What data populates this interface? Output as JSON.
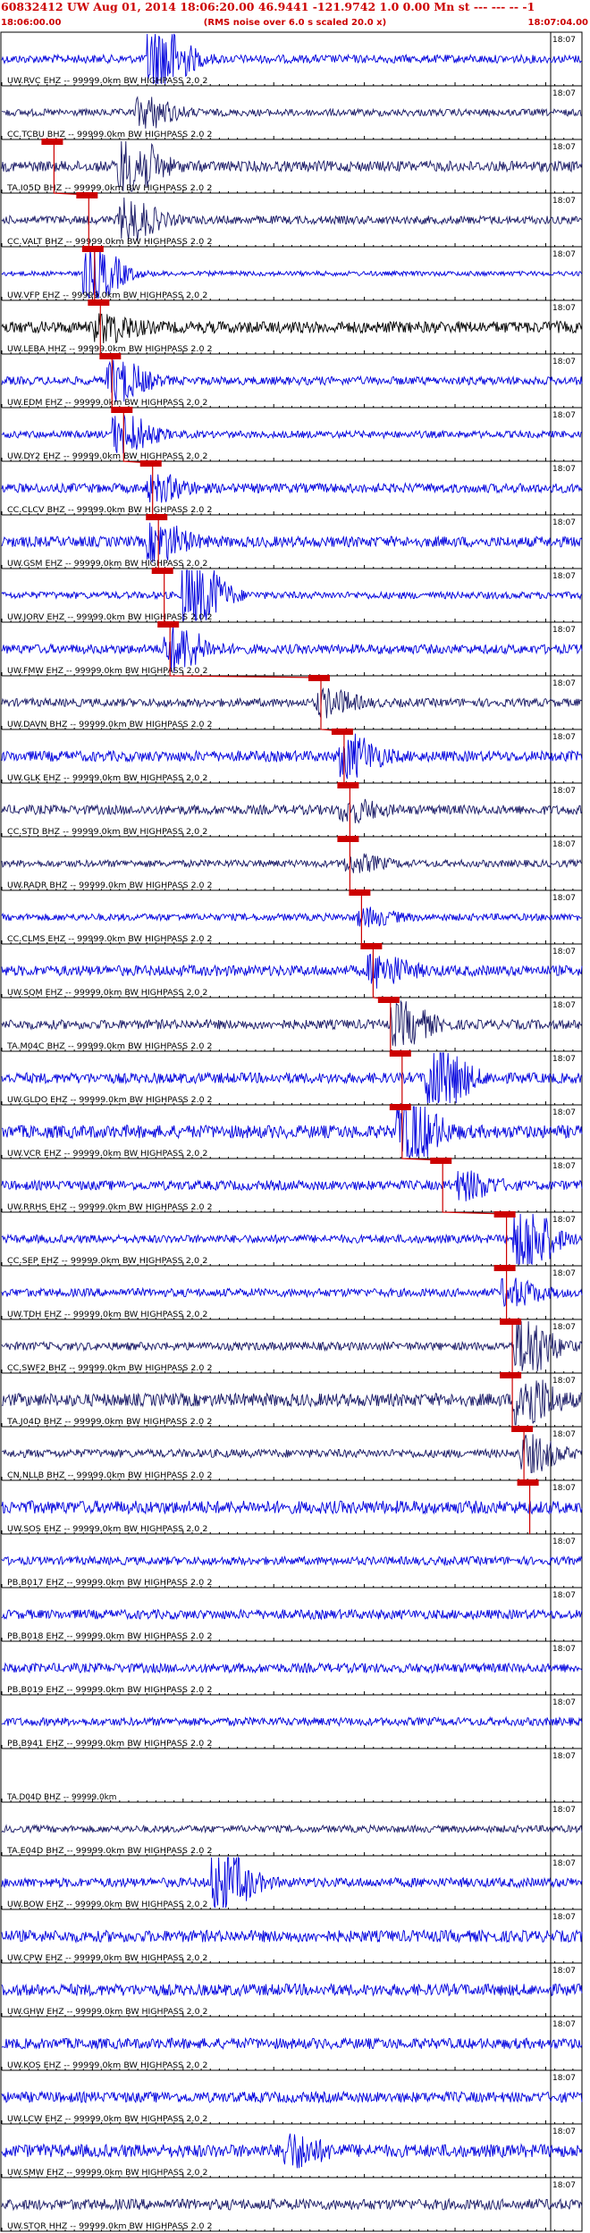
{
  "header": {
    "title": "60832412 UW Aug 01, 2014 18:06:20.00    46.9441 -121.9742  1.0 0.00 Mn st --- --- --  -1",
    "start_time": "18:06:00.00",
    "rms_note": "(RMS noise over 6.0 s scaled 20.0 x)",
    "end_time": "18:07:04.00"
  },
  "chart_data": {
    "type": "line",
    "title": "60832412 UW Aug 01, 2014 18:06:20.00    46.9441 -121.9742  1.0 0.00 Mn st --- --- --  -1",
    "xlabel": "",
    "ylabel": "",
    "x_range": [
      "18:06:00.00",
      "18:07:04.00"
    ],
    "minute_label": "18:07",
    "colors": {
      "title": "#cc0000",
      "grid": "#000000",
      "pick": "#cc0000",
      "trace_blue": "#0000dd",
      "trace_dark": "#1a1a66",
      "trace_black": "#000000"
    },
    "channels": [
      {
        "label": "UW.RVC EHZ -- 99999.0km BW  HIGHPASS  2.0  2",
        "pick": null,
        "color": "blue",
        "burst": 0.27,
        "burst_amp": 3.2,
        "noise": 0.35
      },
      {
        "label": "CC.TCBU BHZ -- 99999.0km BW  HIGHPASS  2.0  2",
        "pick": null,
        "color": "dark",
        "burst": 0.25,
        "burst_amp": 1.2,
        "noise": 0.3
      },
      {
        "label": "TA.I05D BHZ -- 99999.0km BW  HIGHPASS  2.0  2",
        "pick": 0.09,
        "color": "dark",
        "burst": 0.22,
        "burst_amp": 2.6,
        "noise": 0.45
      },
      {
        "label": "CC.VALT BHZ -- 99999.0km BW  HIGHPASS  2.0  2",
        "pick": 0.15,
        "color": "dark",
        "burst": 0.22,
        "burst_amp": 1.6,
        "noise": 0.35
      },
      {
        "label": "UW.VFP EHZ -- 99999.0km BW  HIGHPASS  2.0  2",
        "pick": 0.16,
        "color": "blue",
        "burst": 0.16,
        "burst_amp": 2.2,
        "noise": 0.2
      },
      {
        "label": "UW.LEBA HHZ -- 99999.0km BW  HIGHPASS  2.0  2",
        "pick": 0.17,
        "color": "black",
        "burst": 0.18,
        "burst_amp": 1.0,
        "noise": 0.5
      },
      {
        "label": "UW.EDM EHZ -- 99999.0km BW  HIGHPASS  2.0  2",
        "pick": 0.19,
        "color": "blue",
        "burst": 0.2,
        "burst_amp": 1.6,
        "noise": 0.35
      },
      {
        "label": "UW.DY2 EHZ -- 99999.0km BW  HIGHPASS  2.0  2",
        "pick": 0.21,
        "color": "blue",
        "burst": 0.21,
        "burst_amp": 1.6,
        "noise": 0.3
      },
      {
        "label": "CC.CLCV BHZ -- 99999.0km BW  HIGHPASS  2.0  2",
        "pick": 0.26,
        "color": "blue",
        "burst": 0.27,
        "burst_amp": 0.9,
        "noise": 0.4
      },
      {
        "label": "UW.GSM EHZ -- 99999.0km BW  HIGHPASS  2.0  2",
        "pick": 0.27,
        "color": "blue",
        "burst": 0.27,
        "burst_amp": 1.4,
        "noise": 0.45
      },
      {
        "label": "UW.JORV EHZ -- 99999.0km BW  HIGHPASS  2.0  2",
        "pick": 0.28,
        "color": "blue",
        "burst": 0.33,
        "burst_amp": 3.4,
        "noise": 0.3
      },
      {
        "label": "UW.FMW EHZ -- 99999.0km BW  HIGHPASS  2.0  2",
        "pick": 0.29,
        "color": "blue",
        "burst": 0.3,
        "burst_amp": 1.8,
        "noise": 0.4
      },
      {
        "label": "UW.DAVN BHZ -- 99999.0km BW  HIGHPASS  2.0  2",
        "pick": 0.55,
        "color": "dark",
        "burst": 0.56,
        "burst_amp": 1.0,
        "noise": 0.35
      },
      {
        "label": "UW.GLK EHZ -- 99999.0km BW  HIGHPASS  2.0  2",
        "pick": 0.59,
        "color": "blue",
        "burst": 0.6,
        "burst_amp": 1.6,
        "noise": 0.45
      },
      {
        "label": "CC.STD BHZ -- 99999.0km BW  HIGHPASS  2.0  2",
        "pick": 0.6,
        "color": "dark",
        "burst": 0.6,
        "burst_amp": 0.8,
        "noise": 0.4
      },
      {
        "label": "UW.RADR BHZ -- 99999.0km BW  HIGHPASS  2.0  2",
        "pick": 0.6,
        "color": "dark",
        "burst": 0.61,
        "burst_amp": 0.6,
        "noise": 0.3
      },
      {
        "label": "CC.CLMS EHZ -- 99999.0km BW  HIGHPASS  2.0  2",
        "pick": 0.62,
        "color": "blue",
        "burst": 0.63,
        "burst_amp": 0.6,
        "noise": 0.3
      },
      {
        "label": "UW.SQM EHZ -- 99999.0km BW  HIGHPASS  2.0  2",
        "pick": 0.64,
        "color": "blue",
        "burst": 0.65,
        "burst_amp": 1.2,
        "noise": 0.45
      },
      {
        "label": "TA.M04C BHZ -- 99999.0km BW  HIGHPASS  2.0  2",
        "pick": 0.67,
        "color": "dark",
        "burst": 0.69,
        "burst_amp": 1.6,
        "noise": 0.4
      },
      {
        "label": "UW.GLDO EHZ -- 99999.0km BW  HIGHPASS  2.0  2",
        "pick": 0.69,
        "color": "blue",
        "burst": 0.75,
        "burst_amp": 3.0,
        "noise": 0.45
      },
      {
        "label": "UW.VCR EHZ -- 99999.0km BW  HIGHPASS  2.0  2",
        "pick": 0.69,
        "color": "blue",
        "burst": 0.7,
        "burst_amp": 3.0,
        "noise": 0.55
      },
      {
        "label": "UW.RRHS EHZ -- 99999.0km BW  HIGHPASS  2.0  2",
        "pick": 0.76,
        "color": "blue",
        "burst": 0.8,
        "burst_amp": 1.0,
        "noise": 0.4
      },
      {
        "label": "CC.SEP EHZ -- 99999.0km BW  HIGHPASS  2.0  2",
        "pick": 0.87,
        "color": "blue",
        "burst": 0.9,
        "burst_amp": 3.0,
        "noise": 0.35
      },
      {
        "label": "UW.TDH EHZ -- 99999.0km BW  HIGHPASS  2.0  2",
        "pick": 0.87,
        "color": "blue",
        "burst": 0.88,
        "burst_amp": 1.0,
        "noise": 0.35
      },
      {
        "label": "CC.SWF2 BHZ -- 99999.0km BW  HIGHPASS  2.0  2",
        "pick": 0.88,
        "color": "dark",
        "burst": 0.9,
        "burst_amp": 2.6,
        "noise": 0.35
      },
      {
        "label": "TA.J04D BHZ -- 99999.0km BW  HIGHPASS  2.0  2",
        "pick": 0.88,
        "color": "dark",
        "burst": 0.9,
        "burst_amp": 2.2,
        "noise": 0.55
      },
      {
        "label": "CN.NLLB BHZ -- 99999.0km BW  HIGHPASS  2.0  2",
        "pick": 0.9,
        "color": "dark",
        "burst": 0.91,
        "burst_amp": 1.4,
        "noise": 0.35
      },
      {
        "label": "UW.SOS EHZ -- 99999.0km BW  HIGHPASS  2.0  2",
        "pick": 0.91,
        "color": "blue",
        "burst": null,
        "burst_amp": 0,
        "noise": 0.55
      },
      {
        "label": "PB.B017 EHZ -- 99999.0km BW  HIGHPASS  2.0  2",
        "pick": null,
        "color": "blue",
        "burst": null,
        "burst_amp": 0,
        "noise": 0.35
      },
      {
        "label": "PB.B018 EHZ -- 99999.0km BW  HIGHPASS  2.0  2",
        "pick": null,
        "color": "blue",
        "burst": null,
        "burst_amp": 0,
        "noise": 0.4
      },
      {
        "label": "PB.B019 EHZ -- 99999.0km BW  HIGHPASS  2.0  2",
        "pick": null,
        "color": "blue",
        "burst": null,
        "burst_amp": 0,
        "noise": 0.4
      },
      {
        "label": "PB.B941 EHZ -- 99999.0km BW  HIGHPASS  2.0  2",
        "pick": null,
        "color": "blue",
        "burst": null,
        "burst_amp": 0,
        "noise": 0.35
      },
      {
        "label": "TA.D04D BHZ -- 99999.0km",
        "pick": null,
        "color": "blue",
        "burst": null,
        "burst_amp": 0,
        "noise": 0.0
      },
      {
        "label": "TA.E04D BHZ -- 99999.0km BW  HIGHPASS  2.0  2",
        "pick": null,
        "color": "dark",
        "burst": null,
        "burst_amp": 0,
        "noise": 0.3
      },
      {
        "label": "UW.BOW EHZ -- 99999.0km BW  HIGHPASS  2.0  2",
        "pick": null,
        "color": "blue",
        "burst": 0.38,
        "burst_amp": 2.6,
        "noise": 0.4
      },
      {
        "label": "UW.CPW EHZ -- 99999.0km BW  HIGHPASS  2.0  2",
        "pick": null,
        "color": "blue",
        "burst": null,
        "burst_amp": 0,
        "noise": 0.5
      },
      {
        "label": "UW.GHW EHZ -- 99999.0km BW  HIGHPASS  2.0  2",
        "pick": null,
        "color": "blue",
        "burst": null,
        "burst_amp": 0,
        "noise": 0.5
      },
      {
        "label": "UW.KOS EHZ -- 99999.0km BW  HIGHPASS  2.0  2",
        "pick": null,
        "color": "blue",
        "burst": null,
        "burst_amp": 0,
        "noise": 0.45
      },
      {
        "label": "UW.LCW EHZ -- 99999.0km BW  HIGHPASS  2.0  2",
        "pick": null,
        "color": "blue",
        "burst": null,
        "burst_amp": 0,
        "noise": 0.45
      },
      {
        "label": "UW.SMW EHZ -- 99999.0km BW  HIGHPASS  2.0  2",
        "pick": null,
        "color": "blue",
        "burst": 0.5,
        "burst_amp": 1.2,
        "noise": 0.55
      },
      {
        "label": "UW.STOR HHZ -- 99999.0km BW  HIGHPASS  2.0  2",
        "pick": null,
        "color": "dark",
        "burst": null,
        "burst_amp": 0,
        "noise": 0.45
      }
    ]
  }
}
